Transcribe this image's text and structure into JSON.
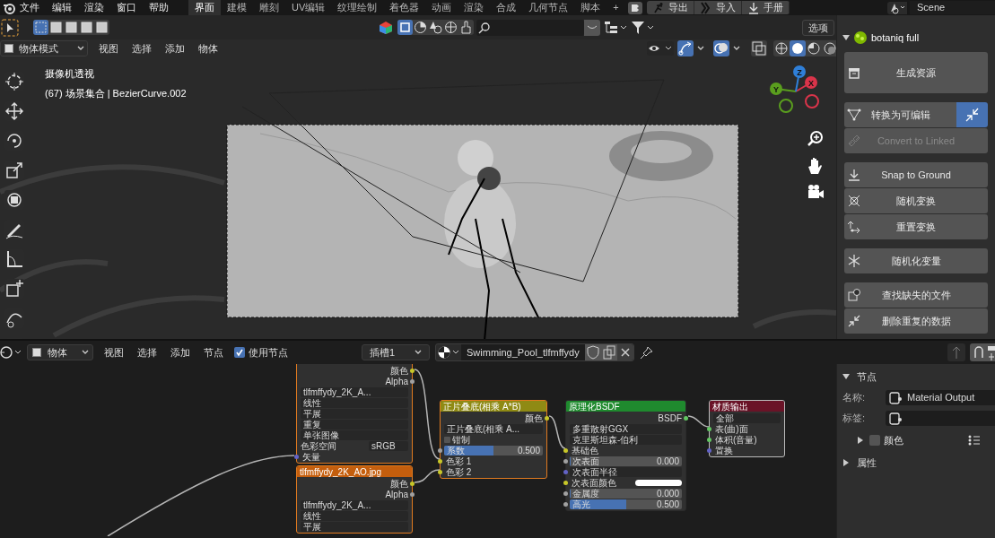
{
  "top_menu": [
    "文件",
    "编辑",
    "渲染",
    "窗口",
    "帮助"
  ],
  "workspace_tabs": [
    {
      "label": "界面",
      "selected": true
    },
    {
      "label": "建模",
      "selected": false
    },
    {
      "label": "雕刻",
      "selected": false
    },
    {
      "label": "UV编辑",
      "selected": false
    },
    {
      "label": "纹理绘制",
      "selected": false
    },
    {
      "label": "着色器",
      "selected": false
    },
    {
      "label": "动画",
      "selected": false
    },
    {
      "label": "渲染",
      "selected": false
    },
    {
      "label": "合成",
      "selected": false
    },
    {
      "label": "几何节点",
      "selected": false
    },
    {
      "label": "脚本",
      "selected": false
    },
    {
      "label": "+",
      "selected": false
    }
  ],
  "header_buttons": [
    {
      "label": "导出",
      "kind": "figure"
    },
    {
      "label": "导入",
      "kind": "chevron"
    },
    {
      "label": "手册",
      "kind": "download"
    }
  ],
  "scene": "Scene",
  "tool_header": {
    "options": "选项"
  },
  "viewport_header": {
    "mode": "物体模式",
    "menus": [
      "视图",
      "选择",
      "添加",
      "物体"
    ]
  },
  "viewport": {
    "overlay_title": "摄像机透视",
    "overlay_info": "(67) 场景集合 | BezierCurve.002",
    "gizmo_axes": [
      "X",
      "Y",
      "Z"
    ]
  },
  "side_panel": {
    "title": "botaniq full",
    "expanded": true,
    "groups": [
      [
        {
          "label": "生成资源",
          "disabled": false,
          "tall": true
        }
      ],
      [
        {
          "label": "转换为可编辑",
          "disabled": false,
          "tall": false,
          "extra_button": true
        },
        {
          "label": "Convert to Linked",
          "disabled": true,
          "tall": false,
          "extra_button": false
        }
      ],
      [
        {
          "label": "Snap to Ground",
          "disabled": false,
          "tall": false
        },
        {
          "label": "随机变换",
          "disabled": false,
          "tall": false
        },
        {
          "label": "重置变换",
          "disabled": false,
          "tall": false
        }
      ],
      [
        {
          "label": "随机化变量",
          "disabled": false,
          "tall": false
        }
      ],
      [
        {
          "label": "查找缺失的文件",
          "disabled": false,
          "tall": false
        },
        {
          "label": "删除重复的数据",
          "disabled": false,
          "tall": false
        }
      ]
    ]
  },
  "node_header": {
    "mode": "物体",
    "menus": [
      "视图",
      "选择",
      "添加",
      "节点"
    ],
    "use_nodes": {
      "label": "使用节点",
      "checked": true
    },
    "slot": "插槽1",
    "material": "Swimming_Pool_tlfmffydy"
  },
  "nodes": [
    {
      "kind": "texture",
      "rows": [
        {
          "kind": "output",
          "label": "颜色",
          "color": "#c7c729"
        },
        {
          "kind": "output",
          "label": "Alpha",
          "color": "#a1a1a1"
        },
        {
          "kind": "image",
          "label": "tlfmffydy_2K_A..."
        },
        {
          "kind": "dropdown",
          "label": "线性"
        },
        {
          "kind": "dropdown",
          "label": "平展"
        },
        {
          "kind": "dropdown",
          "label": "重复"
        },
        {
          "kind": "dropdown",
          "label": "单张图像"
        },
        {
          "kind": "pair",
          "label": "色彩空间",
          "value": "sRGB"
        },
        {
          "kind": "input",
          "label": "矢量",
          "color": "#6363c7"
        }
      ]
    },
    {
      "kind": "texture",
      "title": "tlfmffydy_2K_AO.jpg",
      "rows": [
        {
          "kind": "output",
          "label": "颜色",
          "color": "#c7c729"
        },
        {
          "kind": "output",
          "label": "Alpha",
          "color": "#a1a1a1"
        },
        {
          "kind": "image",
          "label": "tlfmffydy_2K_A..."
        },
        {
          "kind": "dropdown",
          "label": "线性"
        },
        {
          "kind": "dropdown",
          "label": "平展"
        }
      ]
    },
    {
      "kind": "color",
      "title": "正片叠底(相乘 A*B)",
      "rows": [
        {
          "kind": "output",
          "label": "颜色",
          "color": "#c7c729"
        },
        {
          "kind": "dropdown",
          "label": "正片叠底(相乘 A..."
        },
        {
          "kind": "checkbox",
          "label": "钳制",
          "checked": false
        },
        {
          "kind": "slider",
          "label": "系数",
          "value": "0.500",
          "level": 0.5,
          "color": "#a1a1a1"
        },
        {
          "kind": "input",
          "label": "色彩 1",
          "color": "#c7c729"
        },
        {
          "kind": "input",
          "label": "色彩 2",
          "color": "#c7c729"
        }
      ]
    },
    {
      "kind": "shader",
      "title": "原理化BSDF",
      "rows": [
        {
          "kind": "output",
          "label": "BSDF",
          "color": "#63c763"
        },
        {
          "kind": "dropdown",
          "label": "多重散射GGX"
        },
        {
          "kind": "dropdown",
          "label": "克里斯坦森-伯利"
        },
        {
          "kind": "input",
          "label": "基础色",
          "color": "#c7c729"
        },
        {
          "kind": "slider",
          "label": "次表面",
          "value": "0.000",
          "level": 0,
          "color": "#a1a1a1"
        },
        {
          "kind": "dropdown",
          "label": "次表面半径",
          "color": "#6363c7"
        },
        {
          "kind": "swatch",
          "label": "次表面颜色",
          "color": "#c7c729"
        },
        {
          "kind": "slider",
          "label": "金属度",
          "value": "0.000",
          "level": 0,
          "color": "#a1a1a1"
        },
        {
          "kind": "slider",
          "label": "高光",
          "value": "0.500",
          "level": 0.5,
          "color": "#a1a1a1"
        }
      ]
    },
    {
      "kind": "output",
      "title": "材质输出",
      "rows": [
        {
          "kind": "dropdown",
          "label": "全部"
        },
        {
          "kind": "input",
          "label": "表(曲)面",
          "color": "#63c763"
        },
        {
          "kind": "input",
          "label": "体积(音量)",
          "color": "#63c763"
        },
        {
          "kind": "input",
          "label": "置换",
          "color": "#6363c7"
        }
      ]
    }
  ],
  "node_sidebar": {
    "section": "节点",
    "expanded": true,
    "name_label": "名称:",
    "name_value": "Material Output",
    "label_label": "标签:",
    "color": {
      "label": "颜色",
      "checked": false,
      "expanded": false
    },
    "properties": {
      "label": "属性",
      "expanded": false
    }
  }
}
